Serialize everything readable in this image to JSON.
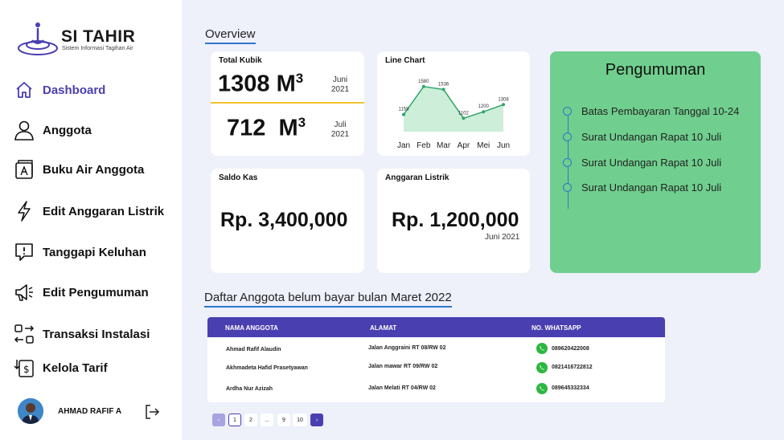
{
  "app": {
    "title": "SI TAHIR",
    "subtitle": "Sistem Informasi Tagihan Air"
  },
  "sidebar": {
    "items": [
      {
        "label": "Dashboard",
        "icon": "home-icon",
        "active": true
      },
      {
        "label": "Anggota",
        "icon": "user-icon"
      },
      {
        "label": "Buku Air Anggota",
        "icon": "book-icon"
      },
      {
        "label": "Edit Anggaran Listrik",
        "icon": "lightning-icon"
      },
      {
        "label": "Tanggapi Keluhan",
        "icon": "feedback-icon"
      },
      {
        "label": "Edit Pengumuman",
        "icon": "megaphone-icon"
      },
      {
        "label": "Transaksi Instalasi",
        "icon": "transfer-icon"
      },
      {
        "label": "Kelola Tarif",
        "icon": "tariff-icon"
      }
    ],
    "profile": {
      "name": "AHMAD RAFIF A"
    }
  },
  "overview": {
    "title": "Overview",
    "total_kubik": {
      "title": "Total Kubik",
      "rows": [
        {
          "value": "1308 M",
          "sup": "3",
          "month": "Juni",
          "year": "2021"
        },
        {
          "value": "712  M",
          "sup": "3",
          "month": "Juli",
          "year": "2021"
        }
      ]
    },
    "line_chart_title": "Line Chart",
    "saldo": {
      "title": "Saldo Kas",
      "value": "Rp. 3,400,000"
    },
    "listrik": {
      "title": "Anggaran Listrik",
      "value": "Rp. 1,200,000",
      "date": "Juni 2021"
    }
  },
  "chart_data": {
    "type": "area",
    "title": "Line Chart",
    "categories": [
      "Jan",
      "Feb",
      "Mar",
      "Apr",
      "Mei",
      "Jun"
    ],
    "values": [
      1158,
      1580,
      1536,
      1102,
      1200,
      1308
    ],
    "color": "#2fa66a"
  },
  "announcements": {
    "title": "Pengumuman",
    "items": [
      "Batas Pembayaran Tanggal 10-24",
      "Surat Undangan Rapat 10 Juli",
      "Surat Undangan Rapat 10 Juli",
      "Surat Undangan Rapat 10 Juli"
    ]
  },
  "unpaid": {
    "title": "Daftar Anggota belum bayar bulan Maret 2022",
    "columns": [
      "NAMA ANGGOTA",
      "ALAMAT",
      "NO. WHATSAPP"
    ],
    "rows": [
      {
        "name": "Ahmad Rafif Alaudin",
        "address": "Jalan Anggraini RT 08/RW 02",
        "phone": "089620422008"
      },
      {
        "name": "Akhmadeta Hafid Prasetyawan",
        "address": "Jalan mawar RT 09/RW 02",
        "phone": "0821416722812"
      },
      {
        "name": "Ardha Nur Azizah",
        "address": "Jalan Melati RT 04/RW 02",
        "phone": "089645332334"
      }
    ]
  },
  "pagination": {
    "prev": "‹",
    "pages": [
      "1",
      "2",
      "...",
      "9",
      "10"
    ],
    "next": "›",
    "current": "1"
  },
  "colors": {
    "accent": "#4a3fb0",
    "announce_bg": "#70cf8e",
    "underline": "#2e77c9",
    "divider": "#f2c230"
  }
}
